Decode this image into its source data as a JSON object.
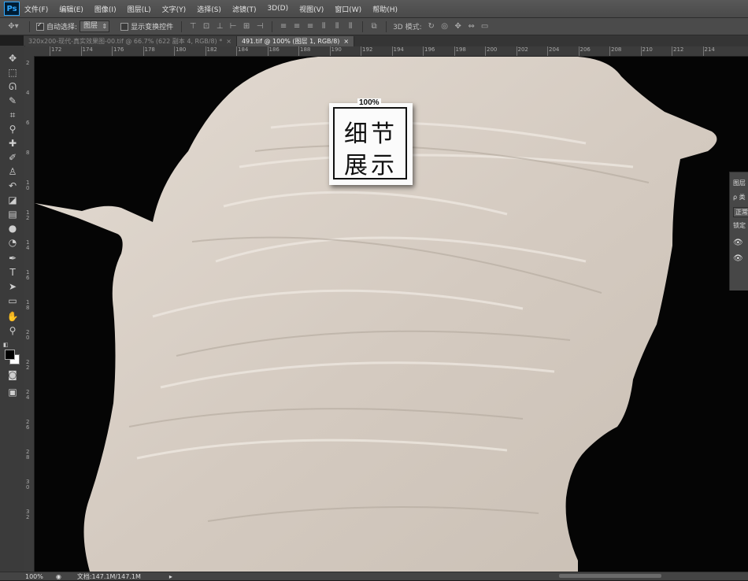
{
  "app": {
    "logo_text": "Ps"
  },
  "menu": [
    "文件(F)",
    "编辑(E)",
    "图像(I)",
    "图层(L)",
    "文字(Y)",
    "选择(S)",
    "滤镜(T)",
    "3D(D)",
    "视图(V)",
    "窗口(W)",
    "帮助(H)"
  ],
  "options": {
    "auto_select_label": "自动选择:",
    "auto_select_checked": true,
    "auto_select_target": "图层",
    "show_transform_label": "显示变换控件",
    "show_transform_checked": false,
    "mode_3d_label": "3D 模式:"
  },
  "tabs": [
    {
      "label": "320x200-现代-真实效果图-00.tif @ 66.7% (622 副本 4, RGB/8) *",
      "active": false
    },
    {
      "label": "491.tif @ 100% (图层 1, RGB/8)",
      "active": true
    }
  ],
  "ruler": {
    "horizontal": [
      "172",
      "174",
      "176",
      "178",
      "180",
      "182",
      "184",
      "186",
      "188",
      "190",
      "192",
      "194",
      "196",
      "198",
      "200",
      "202",
      "204",
      "206",
      "208",
      "210",
      "212",
      "214"
    ],
    "vertical": [
      "2",
      "4",
      "6",
      "8",
      "10",
      "12",
      "14",
      "16",
      "18",
      "20",
      "22",
      "24",
      "26",
      "28",
      "30",
      "32"
    ]
  },
  "badge": {
    "percent": "100%",
    "line1": "细节",
    "line2": "展示"
  },
  "layers_panel": {
    "title": "图层",
    "kind_label": "ρ 类",
    "mode": "正常",
    "lock": "锁定"
  },
  "status": {
    "zoom": "100%",
    "doc_info": "文档:147.1M/147.1M"
  },
  "colors": {
    "foreground": "#000000",
    "background": "#ffffff",
    "feather": "#d9d0c6"
  }
}
